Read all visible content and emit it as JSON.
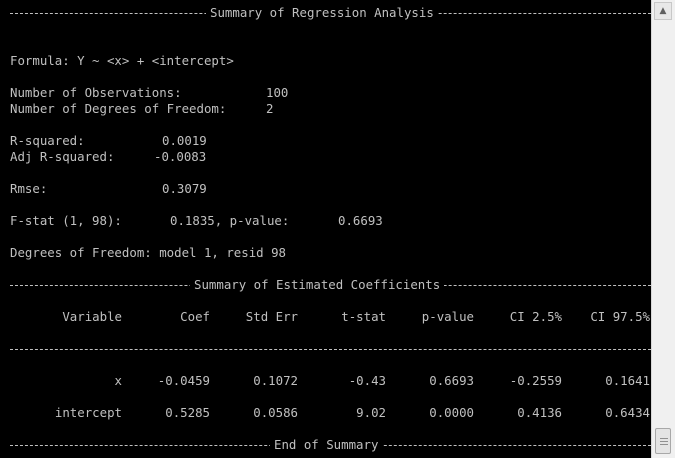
{
  "console": {
    "header_title": "Summary of Regression Analysis",
    "formula": "Formula: Y ~ <x> + <intercept>",
    "observations_label": "Number of Observations:",
    "observations_value": "100",
    "dof_label": "Number of Degrees of Freedom:",
    "dof_value": "2",
    "r_squared_label": "R-squared:",
    "r_squared_value": "0.0019",
    "adj_r_squared_label": "Adj R-squared:",
    "adj_r_squared_value": "-0.0083",
    "rmse_label": "Rmse:",
    "rmse_value": "0.3079",
    "fstat_label": "F-stat (1, 98):",
    "fstat_value": "0.1835, p-value:",
    "pvalue_value": "0.6693",
    "dof_model": "Degrees of Freedom: model 1, resid 98",
    "coef_section_title": "Summary of Estimated Coefficients",
    "columns": [
      "Variable",
      "Coef",
      "Std Err",
      "t-stat",
      "p-value",
      "CI 2.5%",
      "CI 97.5%"
    ],
    "rows": [
      [
        "x",
        "-0.0459",
        "0.1072",
        "-0.43",
        "0.6693",
        "-0.2559",
        "0.1641"
      ],
      [
        "intercept",
        "0.5285",
        "0.0586",
        "9.02",
        "0.0000",
        "0.4136",
        "0.6434"
      ]
    ],
    "footer_title": "End of Summary"
  },
  "scrollbar": {
    "up_icon": "arrow-up-icon",
    "down_icon": "arrow-down-icon"
  }
}
